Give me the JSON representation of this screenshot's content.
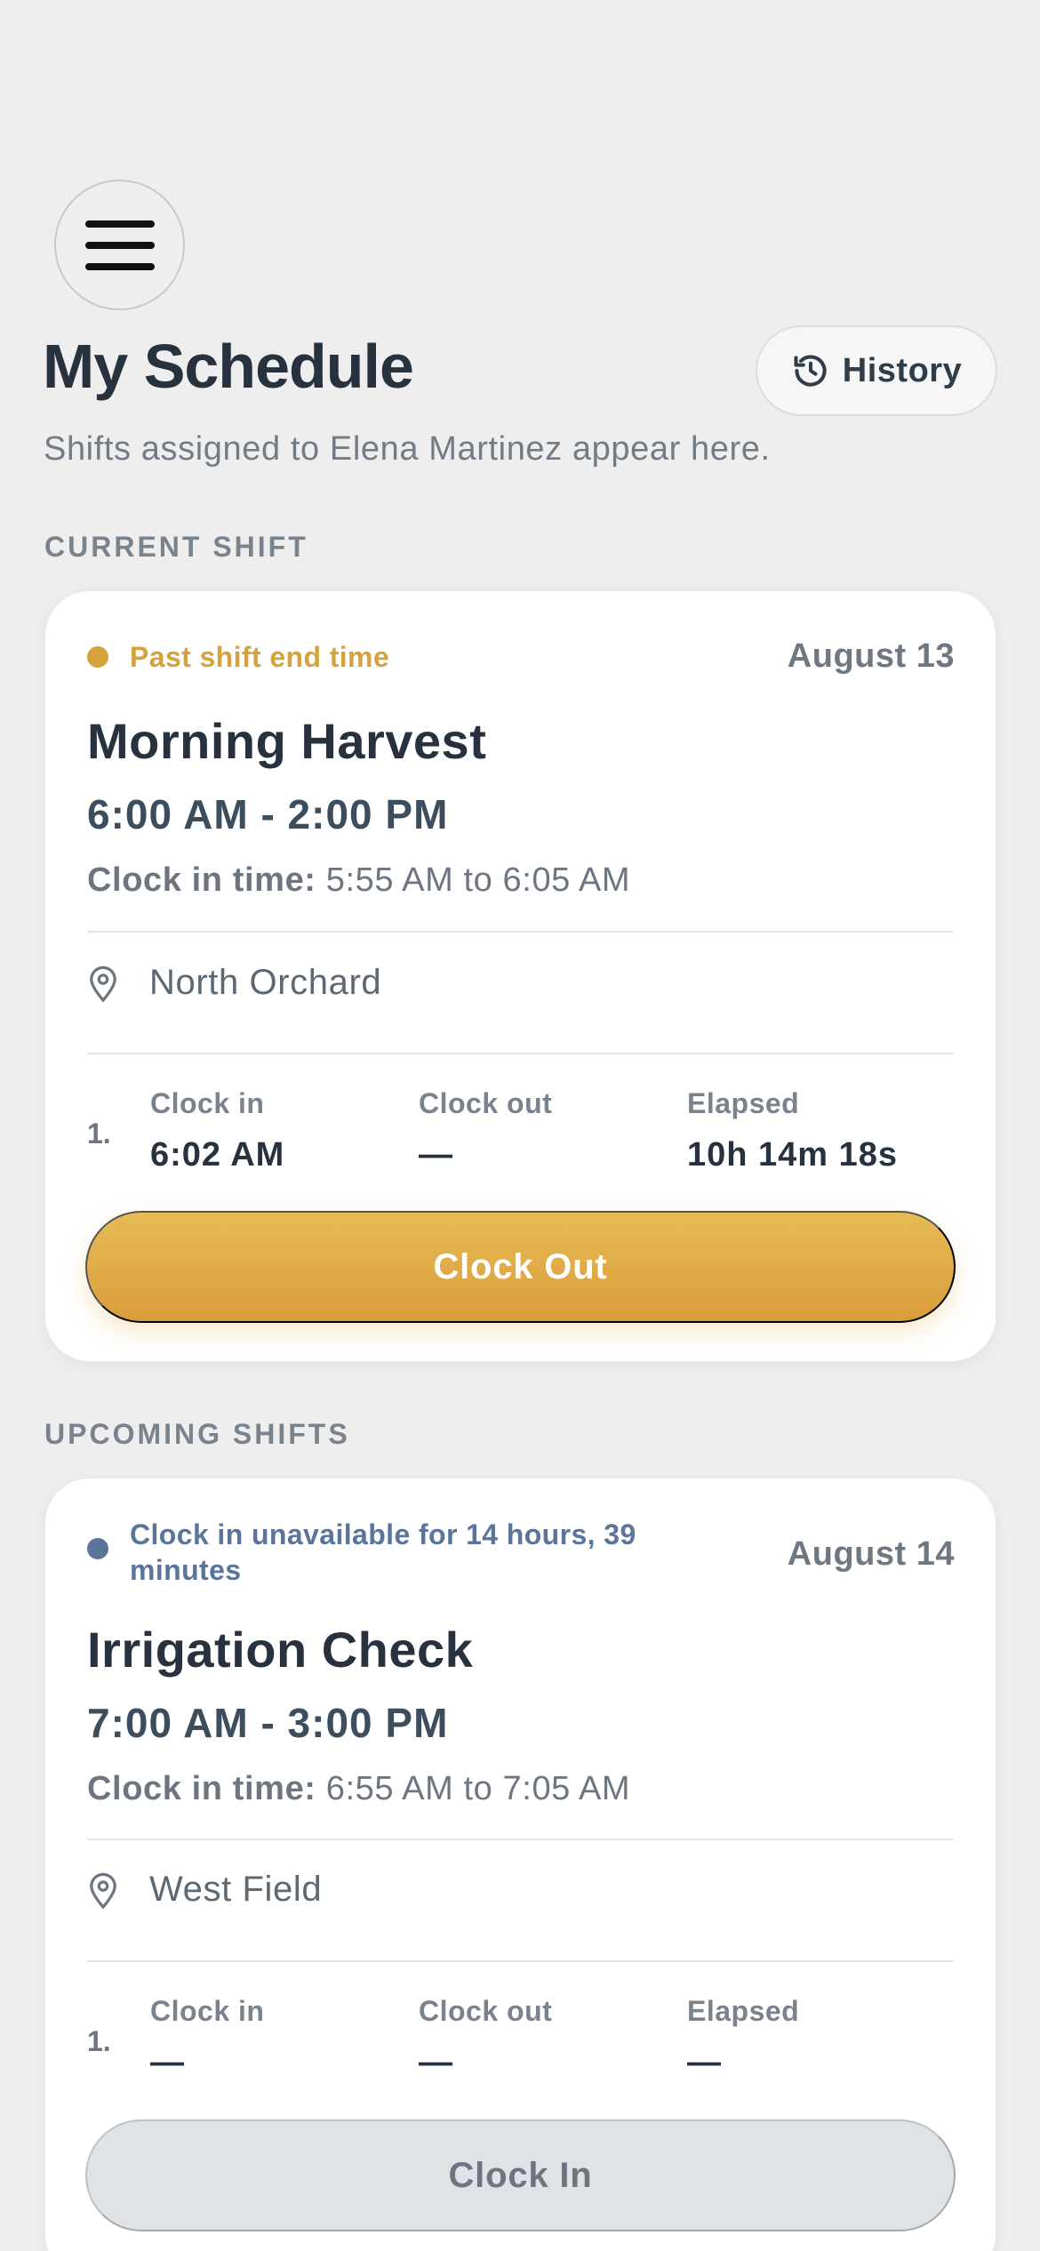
{
  "header": {
    "title": "My Schedule",
    "history_label": "History",
    "subtitle": "Shifts assigned to Elena Martinez appear here."
  },
  "sections": {
    "current": "CURRENT SHIFT",
    "upcoming": "UPCOMING SHIFTS"
  },
  "current_shift": {
    "status": "Past shift end time",
    "status_color": "#d6a23b",
    "date": "August 13",
    "name": "Morning Harvest",
    "time": "6:00 AM - 2:00 PM",
    "clock_window_label": "Clock in time:",
    "clock_window": "5:55 AM to 6:05 AM",
    "location": "North Orchard",
    "entry_number": "1.",
    "clock_in_label": "Clock in",
    "clock_in": "6:02 AM",
    "clock_out_label": "Clock out",
    "clock_out": "—",
    "elapsed_label": "Elapsed",
    "elapsed": "10h 14m 18s",
    "action": "Clock Out"
  },
  "upcoming_shift": {
    "status": "Clock in unavailable for 14 hours, 39 minutes",
    "status_color": "#5a7599",
    "date": "August 14",
    "name": "Irrigation Check",
    "time": "7:00 AM - 3:00 PM",
    "clock_window_label": "Clock in time:",
    "clock_window": "6:55 AM to 7:05 AM",
    "location": "West Field",
    "entry_number": "1.",
    "clock_in_label": "Clock in",
    "clock_in": "—",
    "clock_out_label": "Clock out",
    "clock_out": "—",
    "elapsed_label": "Elapsed",
    "elapsed": "—",
    "action": "Clock In"
  },
  "icons": {
    "menu": "hamburger-menu-icon",
    "history": "history-clock-icon",
    "location": "map-pin-icon"
  }
}
